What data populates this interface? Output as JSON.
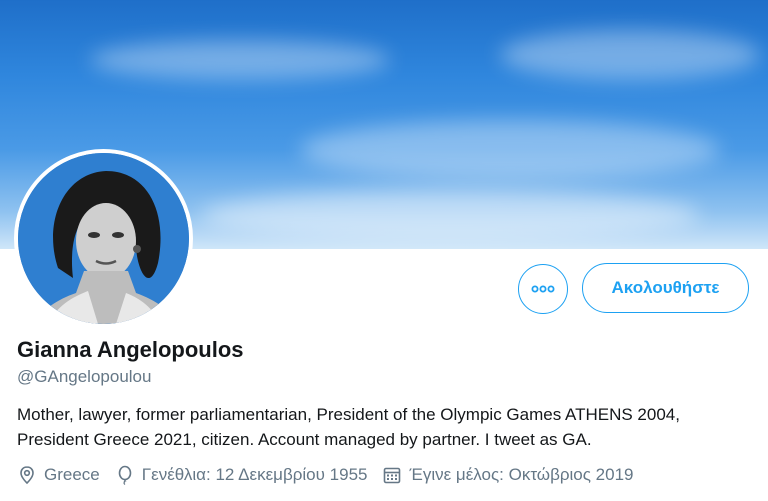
{
  "profile": {
    "name": "Gianna Angelopoulos",
    "handle": "@GAngelopoulou",
    "bio": "Mother, lawyer, former parliamentarian, President of the Olympic Games ATHENS 2004, President Greece 2021, citizen. Account managed by partner. I tweet as GA.",
    "location": "Greece",
    "birthday": "Γενέθλια: 12 Δεκεμβρίου 1955",
    "joined": "Έγινε μέλος: Οκτώβριος 2019"
  },
  "actions": {
    "follow_label": "Ακολουθήστε",
    "more_icon": "more-horizontal-icon"
  },
  "colors": {
    "accent": "#1da1f2",
    "text": "#14171a",
    "secondary": "#657786"
  }
}
